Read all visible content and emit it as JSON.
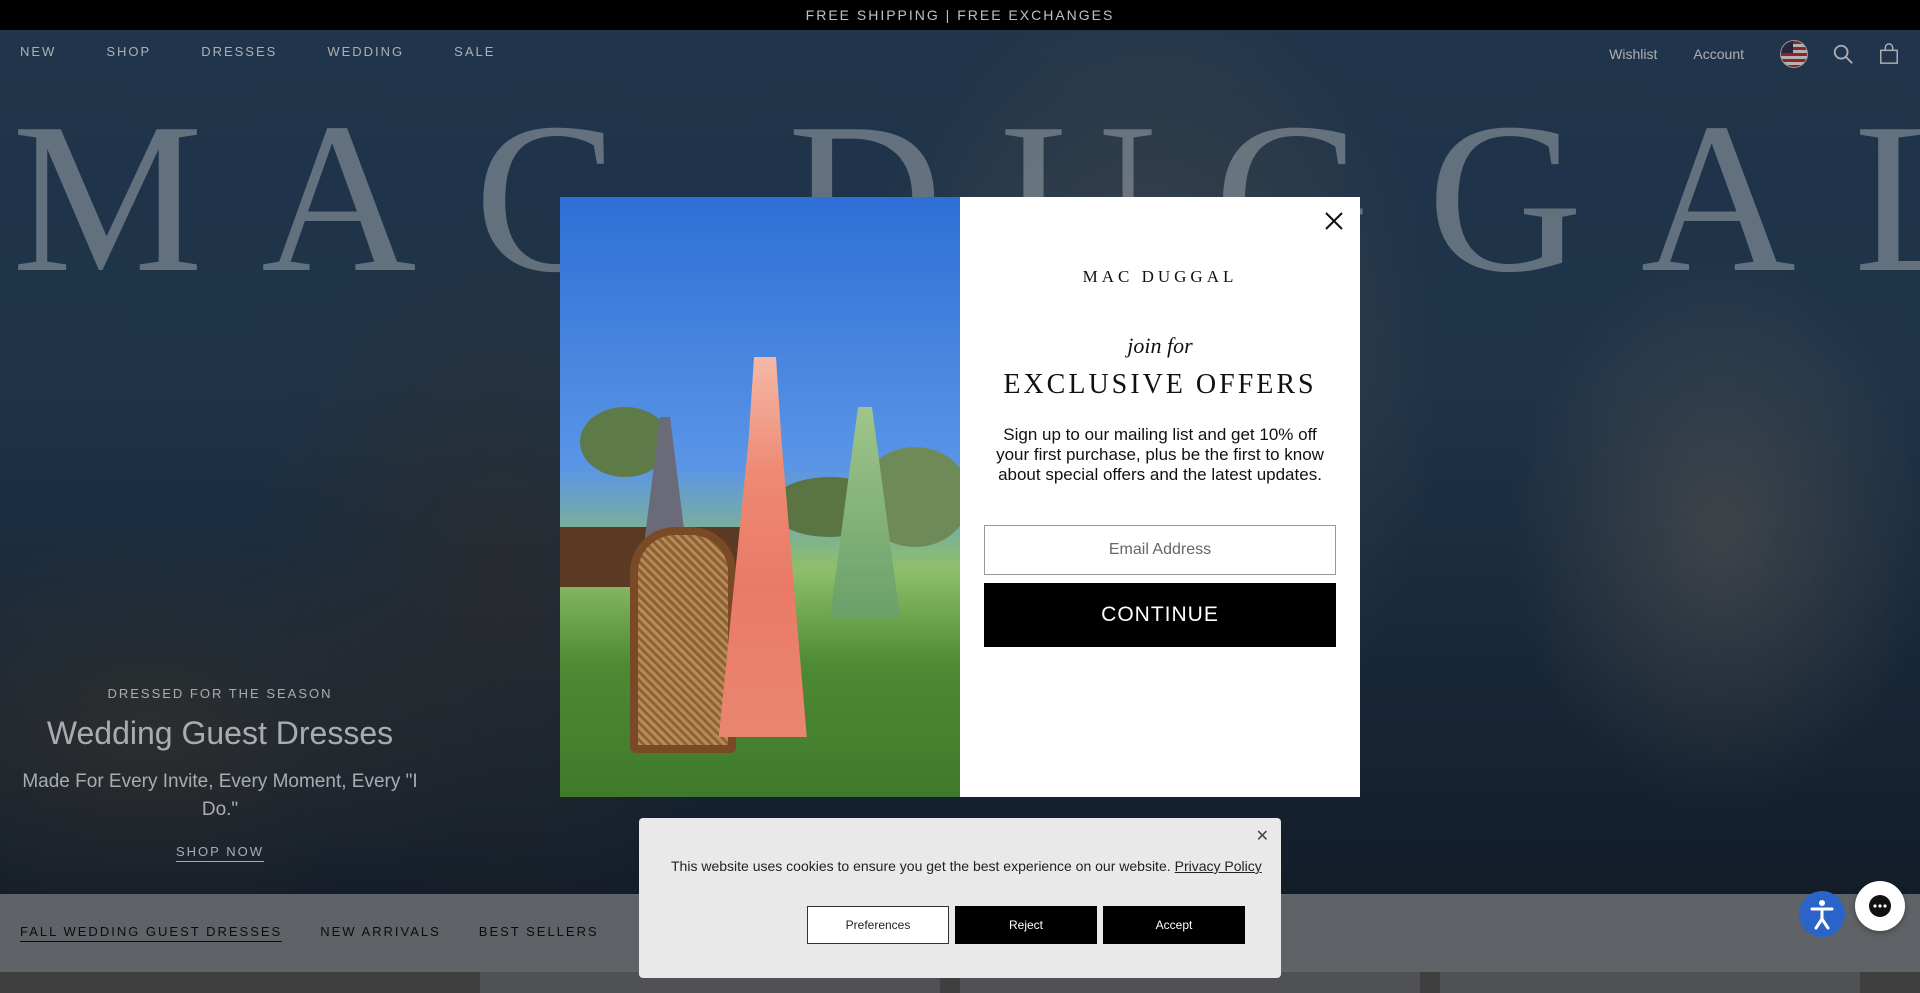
{
  "announcement": "FREE SHIPPING | FREE EXCHANGES",
  "nav": {
    "left": [
      "NEW",
      "SHOP",
      "DRESSES",
      "WEDDING",
      "SALE"
    ],
    "wishlist": "Wishlist",
    "account": "Account"
  },
  "hero": {
    "brand": "MAC DUGGAL",
    "eyebrow": "DRESSED FOR THE SEASON",
    "title": "Wedding Guest Dresses",
    "subtitle": "Made For Every Invite, Every Moment, Every \"I Do.\"",
    "cta": "SHOP NOW"
  },
  "tabs": [
    "FALL WEDDING GUEST DRESSES",
    "NEW ARRIVALS",
    "BEST SELLERS"
  ],
  "modal": {
    "logo": "MAC DUGGAL",
    "join": "join for",
    "offers": "EXCLUSIVE OFFERS",
    "body": "Sign up to our mailing list and get 10% off your first purchase, plus be the first to know about special offers and the latest updates.",
    "email_placeholder": "Email Address",
    "continue": "CONTINUE"
  },
  "cookie": {
    "text": "This website uses cookies to ensure you get the best experience on our website.",
    "link": "Privacy Policy",
    "preferences": "Preferences",
    "reject": "Reject",
    "accept": "Accept"
  },
  "icons": {
    "search": "search-icon",
    "cart": "shopping-bag-icon",
    "flag": "us-flag-icon",
    "close": "close-icon",
    "accessibility": "accessibility-icon",
    "chat": "chat-icon"
  }
}
